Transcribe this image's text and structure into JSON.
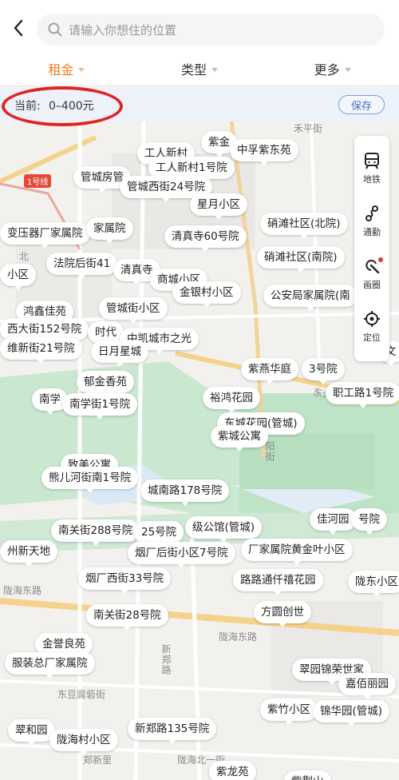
{
  "header": {
    "search_placeholder": "请输入你想住的位置"
  },
  "tabs": [
    {
      "label": "租金",
      "active": true
    },
    {
      "label": "类型",
      "active": false
    },
    {
      "label": "更多",
      "active": false
    }
  ],
  "current_filter": {
    "label": "当前:",
    "value": "0–400元",
    "save_label": "保存"
  },
  "toolbar": [
    {
      "label": "地铁",
      "icon": "subway-icon"
    },
    {
      "label": "通勤",
      "icon": "commute-icon"
    },
    {
      "label": "画圈",
      "icon": "draw-circle-icon"
    },
    {
      "label": "定位",
      "icon": "locate-icon"
    }
  ],
  "road_labels": [
    "1号线",
    "东大街",
    "陇海东路",
    "陇海东路",
    "东豆腐砦街",
    "郑新里",
    "陇海北一街",
    "新郑路",
    "阳街",
    "禾平街",
    "北"
  ],
  "markers": [
    "紫金",
    "中孚紫东苑",
    "工人新村",
    "管城房管",
    "工人新村1号院",
    "管城西街24号院",
    "星月小区",
    "变压器厂家属院",
    "家属院",
    "清真寺60号院",
    "硝滩社区(北院)",
    "硝滩社区(南院)",
    "法院后街41",
    "清真寺",
    "商城小区",
    "小区",
    "鸿鑫佳苑",
    "管城街小区",
    "金银村小区",
    "公安局家属院(南",
    "西大街152号院",
    "时代",
    "中凯城市之光",
    "维新街21号院",
    "日月星城",
    "紫燕华庭",
    "3号院",
    "文",
    "职工路1号院",
    "郁金香苑",
    "南学",
    "南学街1号院",
    "裕鸿花园",
    "东城花园(管城)",
    "紫城公寓",
    "致美公寓",
    "熊儿河街南1号院",
    "城南路178号院",
    "佳河园",
    "级公馆(管城)",
    "号院",
    "南关街288号院",
    "25号院",
    "州新天地",
    "烟厂后街小区7号院",
    "厂家属院黄金叶小区",
    "烟厂西街33号院",
    "路路通仟禧花园",
    "陇东小区",
    "南关街28号院",
    "方圆创世",
    "金誉良苑",
    "服装总厂家属院",
    "翠园锦荣世家",
    "嘉佰丽园",
    "紫竹小区",
    "锦华园(管城)",
    "翠和园",
    "陇海村小区",
    "新郑路135号院",
    "紫龙苑",
    "紫荆山"
  ]
}
